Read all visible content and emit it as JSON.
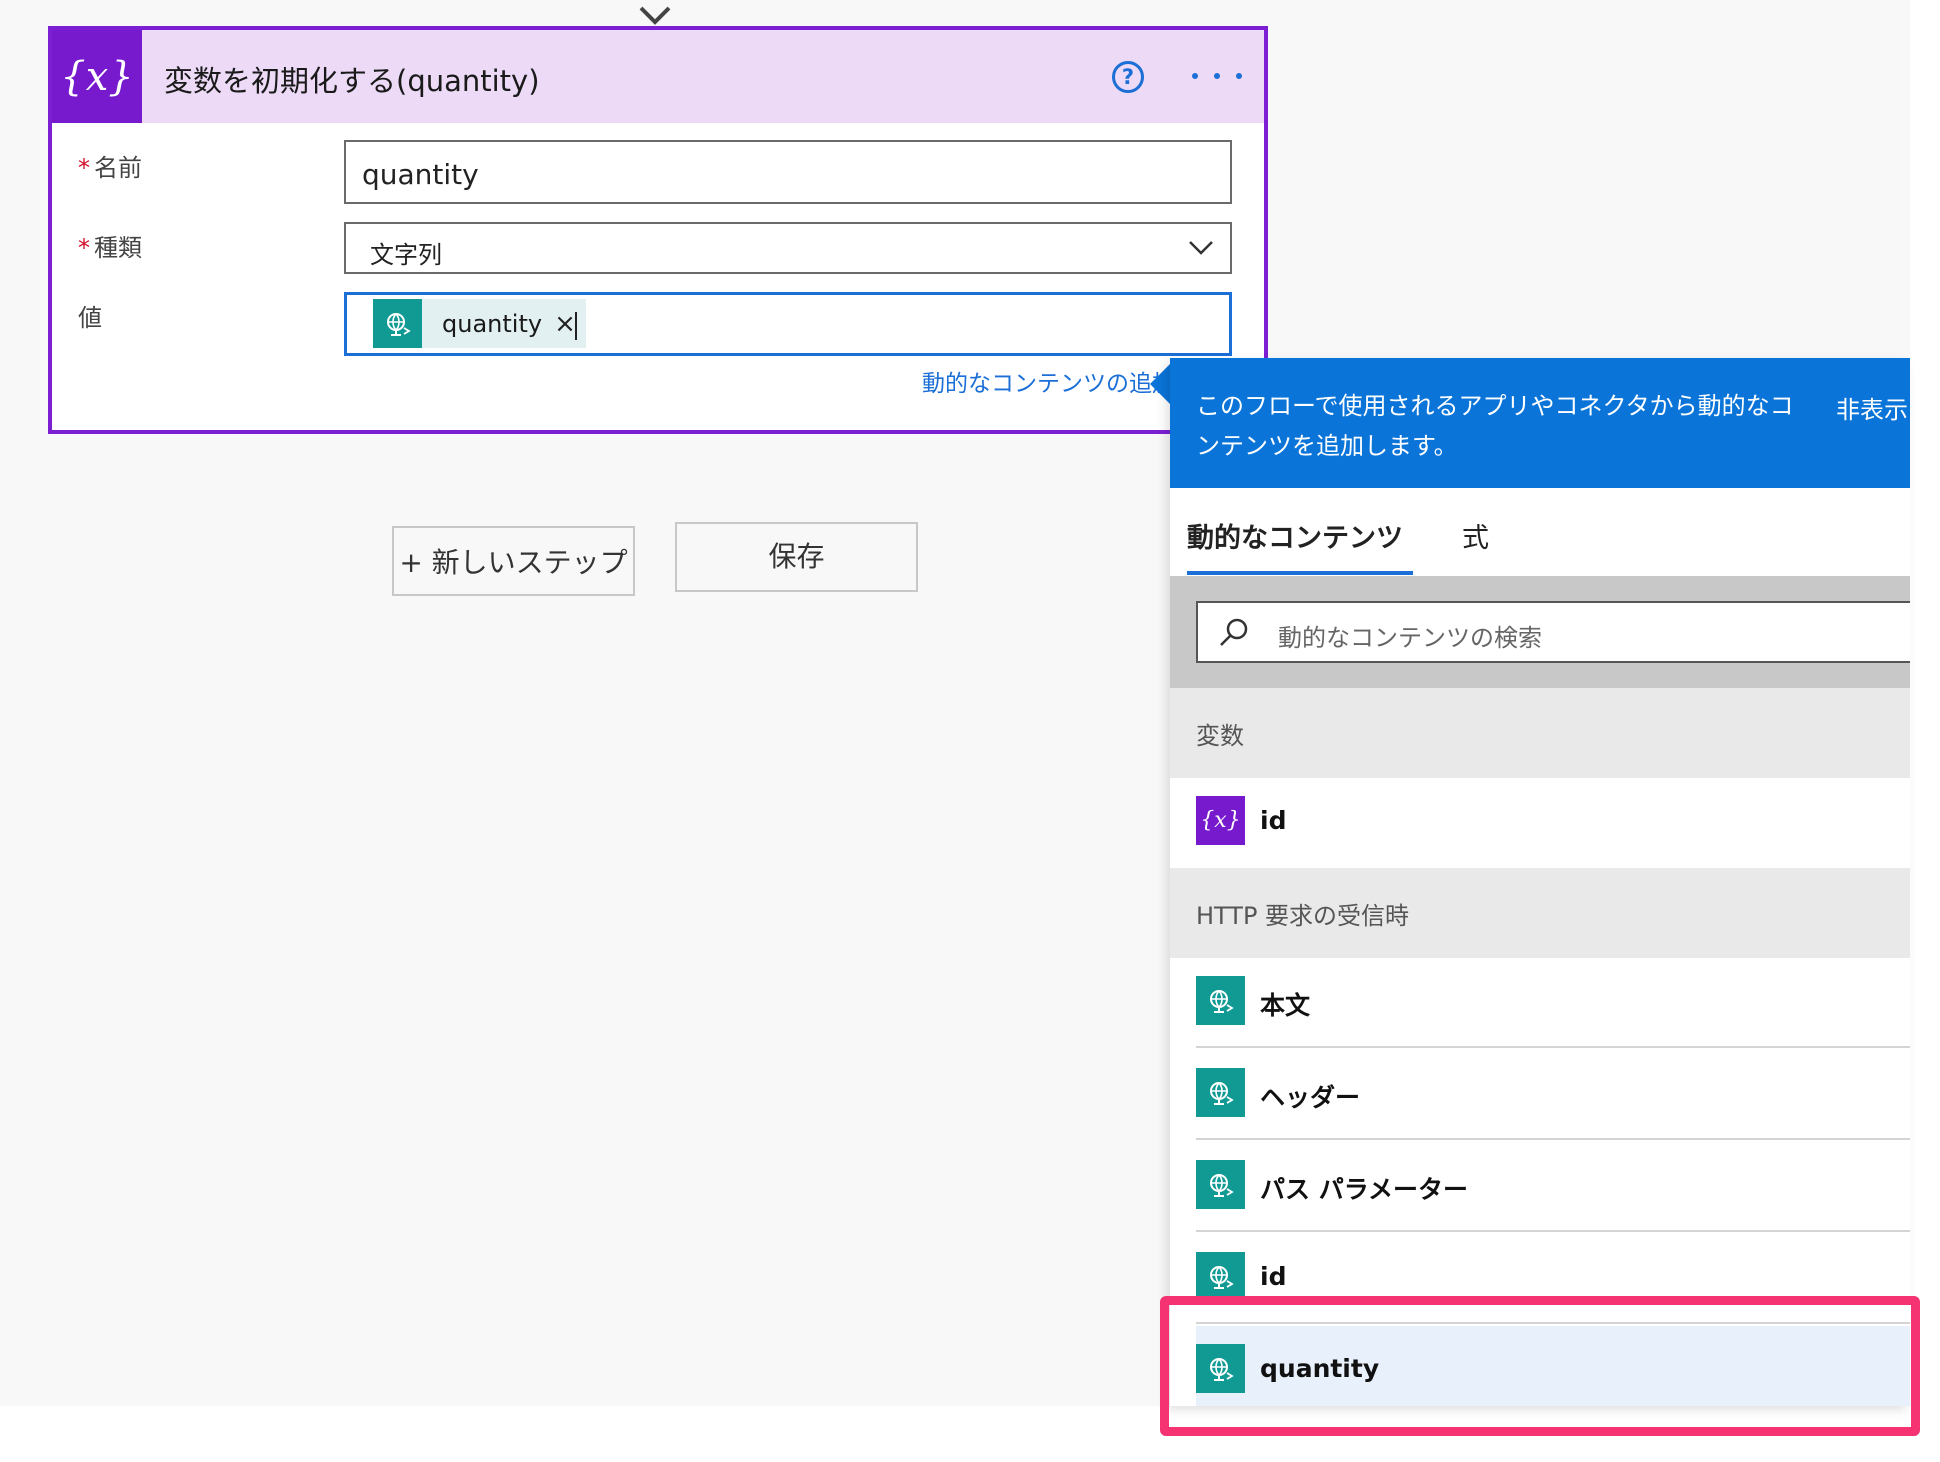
{
  "card": {
    "icon": "{x}",
    "title": "変数を初期化する(quantity)",
    "help_icon": "?",
    "fields": {
      "name_label": "名前",
      "name_value": "quantity",
      "type_label": "種類",
      "type_value": "文字列",
      "value_label": "値",
      "value_token": "quantity",
      "required_mark": "*"
    },
    "token_remove": "×",
    "add_dynamic_link": "動的なコンテンツの追加"
  },
  "buttons": {
    "new_step": "+ 新しいステップ",
    "save": "保存"
  },
  "panel": {
    "description": "このフローで使用されるアプリやコネクタから動的なコンテンツを追加します。",
    "hide_label": "非表示",
    "tabs": [
      "動的なコンテンツ",
      "式"
    ],
    "search_placeholder": "動的なコンテンツの検索",
    "sections": [
      {
        "heading": "変数",
        "items": [
          {
            "label": "id",
            "icon": "variable-icon"
          }
        ]
      },
      {
        "heading": "HTTP 要求の受信時",
        "items": [
          {
            "label": "本文",
            "icon": "http-request-icon"
          },
          {
            "label": "ヘッダー",
            "icon": "http-request-icon"
          },
          {
            "label": "パス パラメーター",
            "icon": "http-request-icon"
          },
          {
            "label": "id",
            "icon": "http-request-icon"
          },
          {
            "label": "quantity",
            "icon": "http-request-icon"
          }
        ]
      }
    ],
    "variable_icon_text": "{x}"
  },
  "colors": {
    "accent_purple": "#7719cc",
    "accent_blue": "#1b6fd6",
    "http_teal": "#119a94",
    "highlight": "#f63372"
  }
}
